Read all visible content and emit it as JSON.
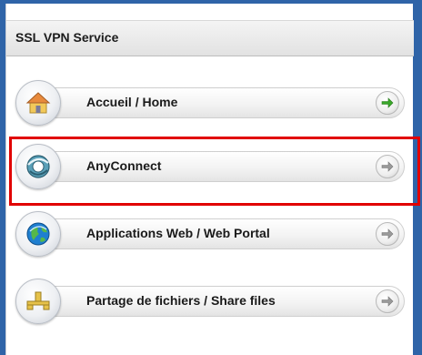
{
  "panel": {
    "title": "SSL VPN Service"
  },
  "menu": {
    "items": [
      {
        "label": "Accueil / Home",
        "icon": "home-icon",
        "arrow_color": "#3aa82a"
      },
      {
        "label": "AnyConnect",
        "icon": "anyconnect-icon",
        "arrow_color": "#9a9a9a"
      },
      {
        "label": "Applications Web / Web Portal",
        "icon": "globe-icon",
        "arrow_color": "#9a9a9a"
      },
      {
        "label": "Partage de fichiers / Share files",
        "icon": "network-share-icon",
        "arrow_color": "#9a9a9a"
      }
    ]
  },
  "colors": {
    "frame": "#2f64a8",
    "highlight": "#e10000",
    "active_arrow": "#3aa82a"
  }
}
